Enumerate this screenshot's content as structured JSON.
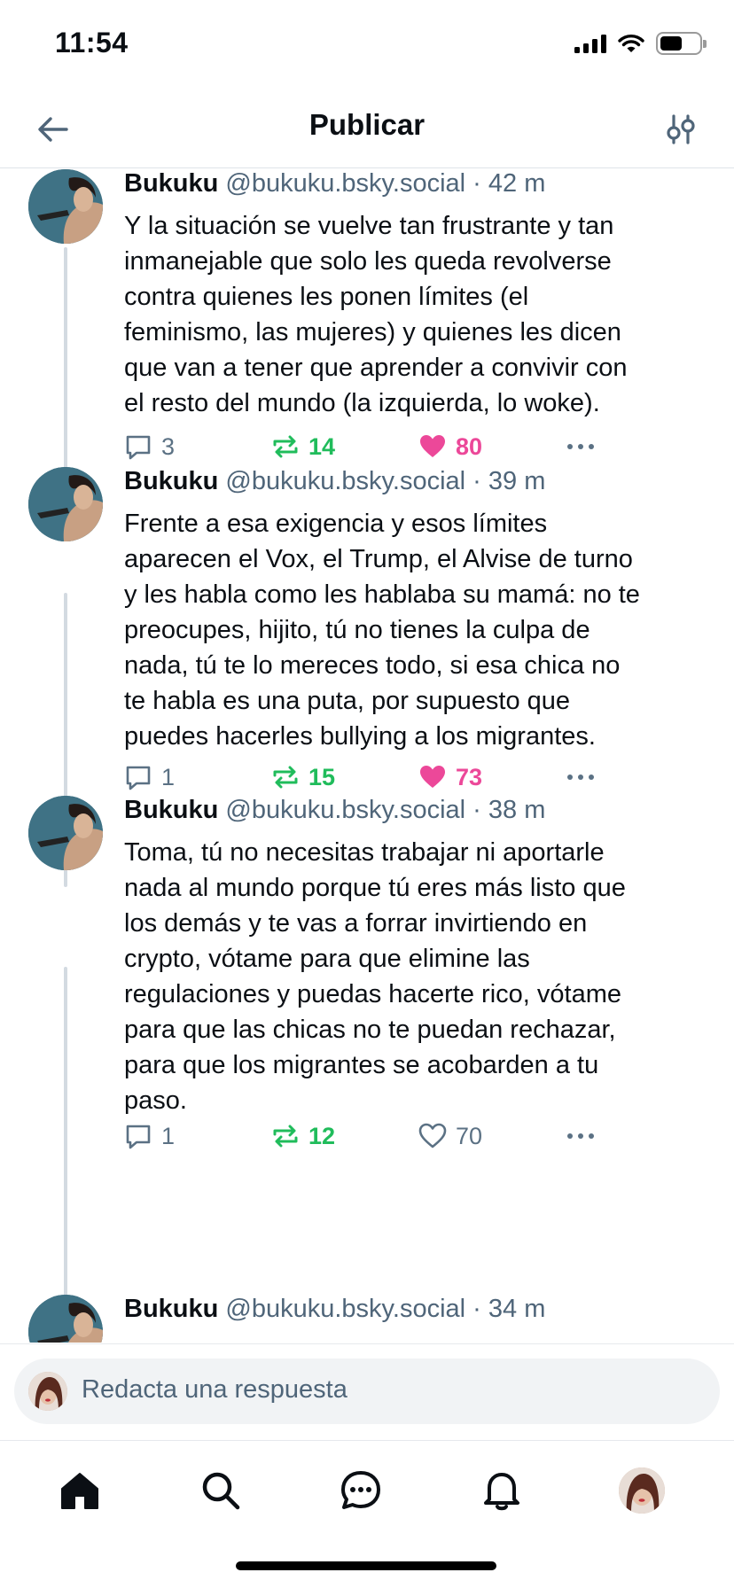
{
  "status_bar": {
    "time": "11:54"
  },
  "header": {
    "title": "Publicar"
  },
  "posts": [
    {
      "author": "Bukuku",
      "handle": "@bukuku.bsky.social",
      "separator": "·",
      "time": "42 m",
      "lines": [
        "Y la situación se vuelve tan frustrante y tan",
        "inmanejable que solo les queda revolverse",
        "contra quienes les ponen límites (el",
        "feminismo, las mujeres) y quienes les dicen",
        "que van a tener que aprender a convivir con",
        "el resto del mundo (la izquierda, lo woke)."
      ],
      "replies": "3",
      "reposts": "14",
      "likes": "80",
      "liked": true
    },
    {
      "author": "Bukuku",
      "handle": "@bukuku.bsky.social",
      "separator": "·",
      "time": "39 m",
      "lines": [
        "Frente a esa exigencia y esos límites",
        "aparecen el Vox, el Trump, el Alvise de turno",
        "y les habla como les hablaba su mamá: no te",
        "preocupes, hijito, tú no tienes la culpa de",
        "nada, tú te lo mereces todo, si esa chica no",
        "te habla es una puta, por supuesto que",
        "puedes hacerles bullying a los migrantes."
      ],
      "replies": "1",
      "reposts": "15",
      "likes": "73",
      "liked": true
    },
    {
      "author": "Bukuku",
      "handle": "@bukuku.bsky.social",
      "separator": "·",
      "time": "38 m",
      "lines": [
        "Toma, tú no necesitas trabajar ni aportarle",
        "nada al mundo porque tú eres más listo que",
        "los demás y te vas a forrar invirtiendo en",
        "crypto, vótame para que elimine las",
        "regulaciones y puedas hacerte rico, vótame",
        "para que las chicas no te puedan rechazar,",
        "para que los migrantes se acobarden a tu",
        "paso."
      ],
      "replies": "1",
      "reposts": "12",
      "likes": "70",
      "liked": false
    },
    {
      "author": "Bukuku",
      "handle": "@bukuku.bsky.social",
      "separator": "·",
      "time": "34 m"
    }
  ],
  "composer": {
    "placeholder": "Redacta una respuesta"
  },
  "icons": {
    "back": "arrow-left-icon",
    "settings": "sliders-icon",
    "reply": "comment-icon",
    "repost": "repost-icon",
    "like": "heart-icon",
    "more": "more-horizontal-icon",
    "tabs": [
      "home-icon",
      "search-icon",
      "chat-icon",
      "bell-icon",
      "profile-avatar"
    ]
  },
  "colors": {
    "text": "#0b0f14",
    "muted": "#4f6579",
    "repost": "#20bc5b",
    "like": "#ec4899",
    "accent": "#1083fe",
    "thread_line": "#d3dae1"
  }
}
